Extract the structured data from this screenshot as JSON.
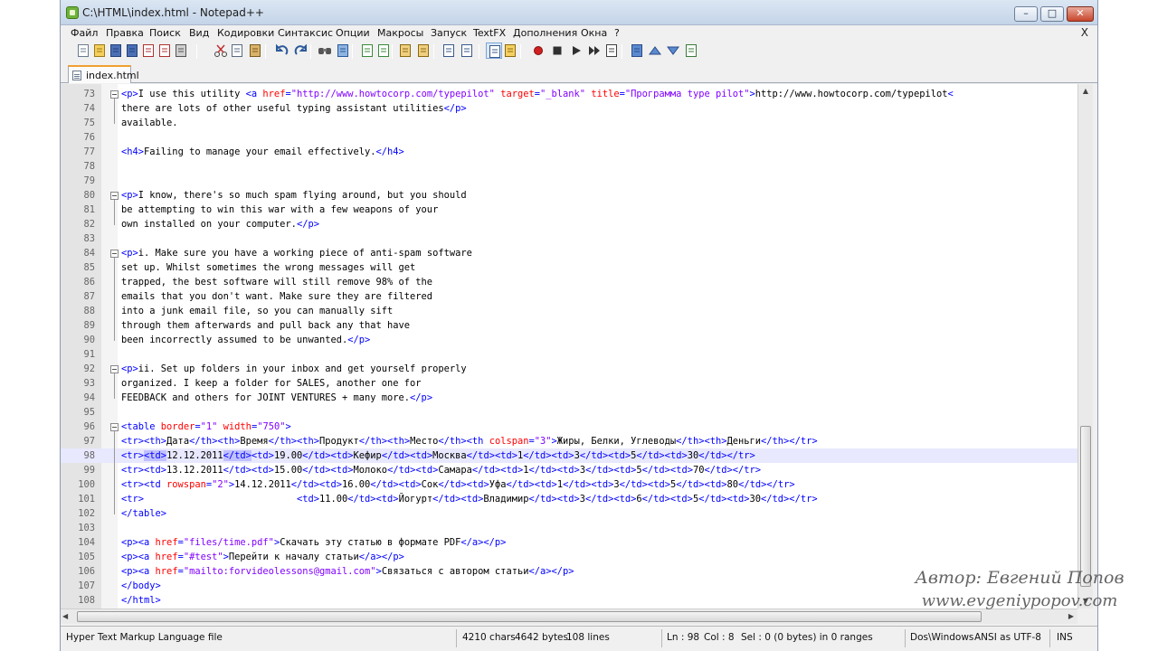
{
  "window": {
    "title": "C:\\HTML\\index.html - Notepad++",
    "minimize": "–",
    "maximize": "□",
    "close": "✕"
  },
  "menu": {
    "items": [
      "Файл",
      "Правка",
      "Поиск",
      "Вид",
      "Кодировки",
      "Синтаксис",
      "Опции",
      "Макросы",
      "Запуск",
      "TextFX",
      "Дополнения",
      "Окна",
      "?"
    ],
    "close_label": "X"
  },
  "toolbar": {
    "buttons": [
      "new-icon",
      "open-icon",
      "save-icon",
      "save-all-icon",
      "close-icon",
      "close-all-icon",
      "print-icon",
      "cut-icon",
      "copy-icon",
      "paste-icon",
      "undo-icon",
      "redo-icon",
      "find-icon",
      "replace-icon",
      "zoom-in-icon",
      "zoom-out-icon",
      "sync-v-icon",
      "sync-h-icon",
      "wrap-icon",
      "all-chars-icon",
      "indent-guide-icon",
      "user-lang-icon",
      "record-macro-icon",
      "stop-macro-icon",
      "play-macro-icon",
      "run-macro-icon",
      "save-macro-icon",
      "trim-icon",
      "up-icon",
      "down-icon",
      "spell-icon"
    ],
    "active": "indent-guide-icon"
  },
  "tab": {
    "label": "index.html"
  },
  "editor": {
    "current_line": "98",
    "lines": [
      {
        "n": "73",
        "fold": true,
        "code": [
          [
            "t",
            "<p>"
          ],
          [
            "k",
            "I use this utility "
          ],
          [
            "t",
            "<a "
          ],
          [
            "a",
            "href"
          ],
          [
            "t",
            "="
          ],
          [
            "v",
            "\"http://www.howtocorp.com/typepilot\""
          ],
          [
            "k",
            " "
          ],
          [
            "a",
            "target"
          ],
          [
            "t",
            "="
          ],
          [
            "v",
            "\"_blank\""
          ],
          [
            "k",
            " "
          ],
          [
            "a",
            "title"
          ],
          [
            "t",
            "="
          ],
          [
            "v",
            "\"Программа type pilot\""
          ],
          [
            "t",
            ">"
          ],
          [
            "k",
            "http://www.howtocorp.com/typepilot"
          ],
          [
            "t",
            "<"
          ]
        ]
      },
      {
        "n": "74",
        "code": [
          [
            "k",
            "there are lots of other useful typing assistant utilities"
          ],
          [
            "t",
            "</p>"
          ]
        ]
      },
      {
        "n": "75",
        "code": [
          [
            "k",
            "available."
          ]
        ]
      },
      {
        "n": "76",
        "code": []
      },
      {
        "n": "77",
        "code": [
          [
            "t",
            "<h4>"
          ],
          [
            "k",
            "Failing to manage your email effectively."
          ],
          [
            "t",
            "</h4>"
          ]
        ]
      },
      {
        "n": "78",
        "code": []
      },
      {
        "n": "79",
        "code": []
      },
      {
        "n": "80",
        "fold": true,
        "code": [
          [
            "t",
            "<p>"
          ],
          [
            "k",
            "I know, there's so much spam flying around, but you should"
          ]
        ]
      },
      {
        "n": "81",
        "code": [
          [
            "k",
            "be attempting to win this war with a few weapons of your"
          ]
        ]
      },
      {
        "n": "82",
        "code": [
          [
            "k",
            "own installed on your computer."
          ],
          [
            "t",
            "</p>"
          ]
        ]
      },
      {
        "n": "83",
        "code": []
      },
      {
        "n": "84",
        "fold": true,
        "code": [
          [
            "t",
            "<p>"
          ],
          [
            "k",
            "i. Make sure you have a working piece of anti-spam software"
          ]
        ]
      },
      {
        "n": "85",
        "code": [
          [
            "k",
            "set up. Whilst sometimes the wrong messages will get"
          ]
        ]
      },
      {
        "n": "86",
        "code": [
          [
            "k",
            "trapped, the best software will still remove 98% of the"
          ]
        ]
      },
      {
        "n": "87",
        "code": [
          [
            "k",
            "emails that you don't want. Make sure they are filtered"
          ]
        ]
      },
      {
        "n": "88",
        "code": [
          [
            "k",
            "into a junk email file, so you can manually sift"
          ]
        ]
      },
      {
        "n": "89",
        "code": [
          [
            "k",
            "through them afterwards and pull back any that have"
          ]
        ]
      },
      {
        "n": "90",
        "code": [
          [
            "k",
            "been incorrectly assumed to be unwanted."
          ],
          [
            "t",
            "</p>"
          ]
        ]
      },
      {
        "n": "91",
        "code": []
      },
      {
        "n": "92",
        "fold": true,
        "code": [
          [
            "t",
            "<p>"
          ],
          [
            "k",
            "ii. Set up folders in your inbox and get yourself properly"
          ]
        ]
      },
      {
        "n": "93",
        "code": [
          [
            "k",
            "organized. I keep a folder for SALES, another one for"
          ]
        ]
      },
      {
        "n": "94",
        "code": [
          [
            "k",
            "FEEDBACK and others for JOINT VENTURES + many more."
          ],
          [
            "t",
            "</p>"
          ]
        ]
      },
      {
        "n": "95",
        "code": []
      },
      {
        "n": "96",
        "fold": true,
        "code": [
          [
            "t",
            "<table "
          ],
          [
            "a",
            "border"
          ],
          [
            "t",
            "="
          ],
          [
            "v",
            "\"1\""
          ],
          [
            "k",
            " "
          ],
          [
            "a",
            "width"
          ],
          [
            "t",
            "="
          ],
          [
            "v",
            "\"750\""
          ],
          [
            "t",
            ">"
          ]
        ]
      },
      {
        "n": "97",
        "code": [
          [
            "t",
            "<tr><th>"
          ],
          [
            "k",
            "Дата"
          ],
          [
            "t",
            "</th><th>"
          ],
          [
            "k",
            "Время"
          ],
          [
            "t",
            "</th><th>"
          ],
          [
            "k",
            "Продукт"
          ],
          [
            "t",
            "</th><th>"
          ],
          [
            "k",
            "Место"
          ],
          [
            "t",
            "</th><th "
          ],
          [
            "a",
            "colspan"
          ],
          [
            "t",
            "="
          ],
          [
            "v",
            "\"3\""
          ],
          [
            "t",
            ">"
          ],
          [
            "k",
            "Жиры, Белки, Углеводы"
          ],
          [
            "t",
            "</th><th>"
          ],
          [
            "k",
            "Деньги"
          ],
          [
            "t",
            "</th></tr>"
          ]
        ]
      },
      {
        "n": "98",
        "code": [
          [
            "t",
            "<tr>"
          ],
          [
            "h",
            "<td>"
          ],
          [
            "k",
            "12.12.2011"
          ],
          [
            "h",
            "</td>"
          ],
          [
            "t",
            "<td>"
          ],
          [
            "k",
            "19.00"
          ],
          [
            "t",
            "</td><td>"
          ],
          [
            "k",
            "Кефир"
          ],
          [
            "t",
            "</td><td>"
          ],
          [
            "k",
            "Москва"
          ],
          [
            "t",
            "</td><td>"
          ],
          [
            "k",
            "1"
          ],
          [
            "t",
            "</td><td>"
          ],
          [
            "k",
            "3"
          ],
          [
            "t",
            "</td><td>"
          ],
          [
            "k",
            "5"
          ],
          [
            "t",
            "</td><td>"
          ],
          [
            "k",
            "30"
          ],
          [
            "t",
            "</td></tr>"
          ]
        ]
      },
      {
        "n": "99",
        "code": [
          [
            "t",
            "<tr><td>"
          ],
          [
            "k",
            "13.12.2011"
          ],
          [
            "t",
            "</td><td>"
          ],
          [
            "k",
            "15.00"
          ],
          [
            "t",
            "</td><td>"
          ],
          [
            "k",
            "Молоко"
          ],
          [
            "t",
            "</td><td>"
          ],
          [
            "k",
            "Самара"
          ],
          [
            "t",
            "</td><td>"
          ],
          [
            "k",
            "1"
          ],
          [
            "t",
            "</td><td>"
          ],
          [
            "k",
            "3"
          ],
          [
            "t",
            "</td><td>"
          ],
          [
            "k",
            "5"
          ],
          [
            "t",
            "</td><td>"
          ],
          [
            "k",
            "70"
          ],
          [
            "t",
            "</td></tr>"
          ]
        ]
      },
      {
        "n": "100",
        "code": [
          [
            "t",
            "<tr><td "
          ],
          [
            "a",
            "rowspan"
          ],
          [
            "t",
            "="
          ],
          [
            "v",
            "\"2\""
          ],
          [
            "t",
            ">"
          ],
          [
            "k",
            "14.12.2011"
          ],
          [
            "t",
            "</td><td>"
          ],
          [
            "k",
            "16.00"
          ],
          [
            "t",
            "</td><td>"
          ],
          [
            "k",
            "Сок"
          ],
          [
            "t",
            "</td><td>"
          ],
          [
            "k",
            "Уфа"
          ],
          [
            "t",
            "</td><td>"
          ],
          [
            "k",
            "1"
          ],
          [
            "t",
            "</td><td>"
          ],
          [
            "k",
            "3"
          ],
          [
            "t",
            "</td><td>"
          ],
          [
            "k",
            "5"
          ],
          [
            "t",
            "</td><td>"
          ],
          [
            "k",
            "80"
          ],
          [
            "t",
            "</td></tr>"
          ]
        ]
      },
      {
        "n": "101",
        "code": [
          [
            "t",
            "<tr>"
          ],
          [
            "k",
            "                           "
          ],
          [
            "t",
            "<td>"
          ],
          [
            "k",
            "11.00"
          ],
          [
            "t",
            "</td><td>"
          ],
          [
            "k",
            "Йогурт"
          ],
          [
            "t",
            "</td><td>"
          ],
          [
            "k",
            "Владимир"
          ],
          [
            "t",
            "</td><td>"
          ],
          [
            "k",
            "3"
          ],
          [
            "t",
            "</td><td>"
          ],
          [
            "k",
            "6"
          ],
          [
            "t",
            "</td><td>"
          ],
          [
            "k",
            "5"
          ],
          [
            "t",
            "</td><td>"
          ],
          [
            "k",
            "30"
          ],
          [
            "t",
            "</td></tr>"
          ]
        ]
      },
      {
        "n": "102",
        "code": [
          [
            "t",
            "</table>"
          ]
        ]
      },
      {
        "n": "103",
        "code": []
      },
      {
        "n": "104",
        "code": [
          [
            "t",
            "<p><a "
          ],
          [
            "a",
            "href"
          ],
          [
            "t",
            "="
          ],
          [
            "v",
            "\"files/time.pdf\""
          ],
          [
            "t",
            ">"
          ],
          [
            "k",
            "Скачать эту статью в формате PDF"
          ],
          [
            "t",
            "</a></p>"
          ]
        ]
      },
      {
        "n": "105",
        "code": [
          [
            "t",
            "<p><a "
          ],
          [
            "a",
            "href"
          ],
          [
            "t",
            "="
          ],
          [
            "v",
            "\"#test\""
          ],
          [
            "t",
            ">"
          ],
          [
            "k",
            "Перейти к началу статьи"
          ],
          [
            "t",
            "</a></p>"
          ]
        ]
      },
      {
        "n": "106",
        "code": [
          [
            "t",
            "<p><a "
          ],
          [
            "a",
            "href"
          ],
          [
            "t",
            "="
          ],
          [
            "v",
            "\"mailto:forvideolessons@gmail.com\""
          ],
          [
            "t",
            ">"
          ],
          [
            "k",
            "Связаться с автором статьи"
          ],
          [
            "t",
            "</a></p>"
          ]
        ]
      },
      {
        "n": "107",
        "code": [
          [
            "t",
            "</body>"
          ]
        ]
      },
      {
        "n": "108",
        "code": [
          [
            "t",
            "</html>"
          ]
        ]
      }
    ]
  },
  "status": {
    "file_type": "Hyper Text Markup Language file",
    "chars": "4210 chars",
    "bytes": "4642 bytes",
    "lines": "108 lines",
    "ln": "Ln : 98",
    "col": "Col : 8",
    "sel": "Sel : 0 (0 bytes) in 0 ranges",
    "eol": "Dos\\Windows",
    "encoding": "ANSI as UTF-8",
    "mode": "INS"
  },
  "watermark": {
    "author": "Автор: Евгений Попов",
    "site": "www.evgeniypopov.com"
  }
}
